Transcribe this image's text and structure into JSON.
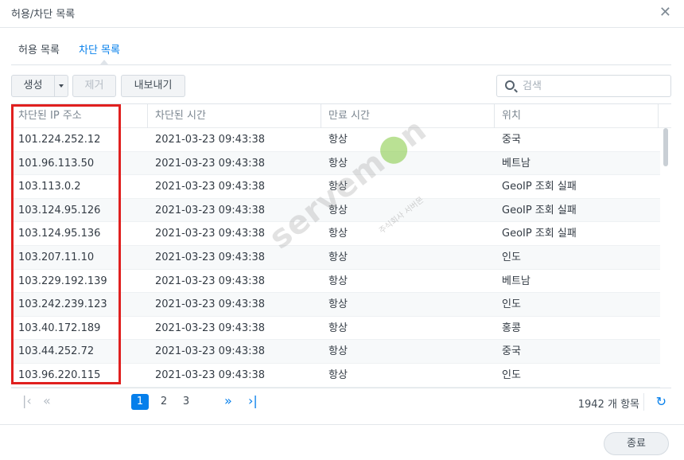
{
  "window": {
    "title": "허용/차단 목록"
  },
  "tabs": [
    {
      "label": "허용 목록",
      "active": false
    },
    {
      "label": "차단 목록",
      "active": true
    }
  ],
  "toolbar": {
    "create_label": "생성",
    "remove_label": "제거",
    "export_label": "내보내기"
  },
  "search": {
    "placeholder": "검색"
  },
  "columns": [
    "차단된 IP 주소",
    "차단된 시간",
    "만료 시간",
    "위치"
  ],
  "rows": [
    [
      "101.224.252.12",
      "2021-03-23 09:43:38",
      "항상",
      "중국"
    ],
    [
      "101.96.113.50",
      "2021-03-23 09:43:38",
      "항상",
      "베트남"
    ],
    [
      "103.113.0.2",
      "2021-03-23 09:43:38",
      "항상",
      "GeoIP 조회 실패"
    ],
    [
      "103.124.95.126",
      "2021-03-23 09:43:38",
      "항상",
      "GeoIP 조회 실패"
    ],
    [
      "103.124.95.136",
      "2021-03-23 09:43:38",
      "항상",
      "GeoIP 조회 실패"
    ],
    [
      "103.207.11.10",
      "2021-03-23 09:43:38",
      "항상",
      "인도"
    ],
    [
      "103.229.192.139",
      "2021-03-23 09:43:38",
      "항상",
      "베트남"
    ],
    [
      "103.242.239.123",
      "2021-03-23 09:43:38",
      "항상",
      "인도"
    ],
    [
      "103.40.172.189",
      "2021-03-23 09:43:38",
      "항상",
      "홍콩"
    ],
    [
      "103.44.252.72",
      "2021-03-23 09:43:38",
      "항상",
      "중국"
    ],
    [
      "103.96.220.115",
      "2021-03-23 09:43:38",
      "항상",
      "인도"
    ]
  ],
  "pager": {
    "pages": [
      "1",
      "2",
      "3"
    ],
    "current_page": "1",
    "total": "1942 개 항목"
  },
  "watermark": {
    "text_a": "serve",
    "text_b": "m",
    "text_c": "n",
    "sub": "주식회사 서버몬"
  },
  "footer": {
    "close_label": "종료"
  },
  "colors": {
    "accent": "#057feb",
    "highlight": "#e0201f"
  }
}
